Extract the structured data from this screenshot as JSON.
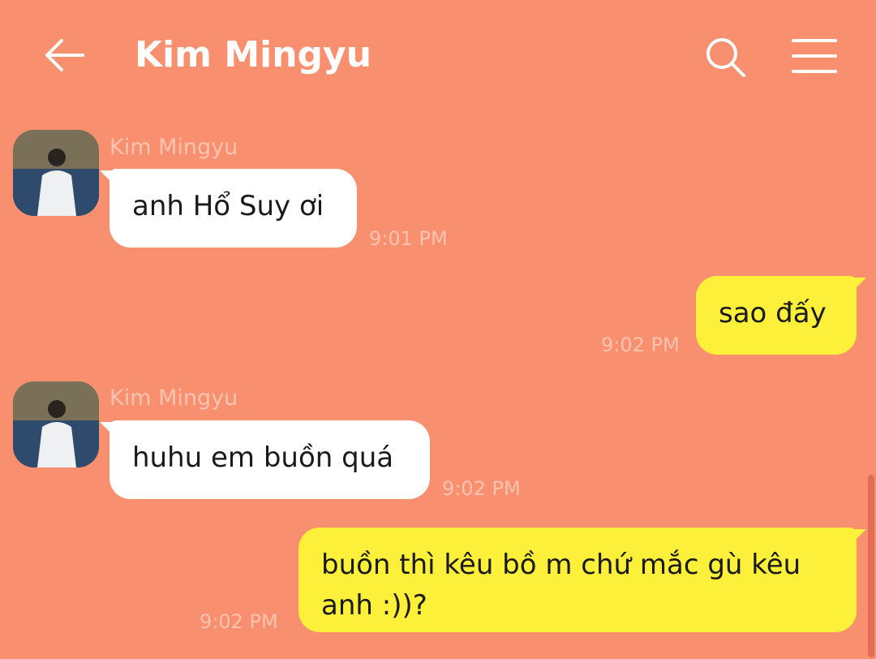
{
  "header": {
    "title": "Kim Mingyu",
    "back_icon": "arrow-left-icon",
    "search_icon": "search-icon",
    "menu_icon": "menu-icon"
  },
  "colors": {
    "background": "#F89070",
    "incoming_bubble": "#FFFFFF",
    "outgoing_bubble": "#FDF03A",
    "meta_text": "#FBC3B0"
  },
  "messages": [
    {
      "direction": "incoming",
      "sender": "Kim Mingyu",
      "text": "anh Hổ Suy ơi",
      "time": "9:01 PM"
    },
    {
      "direction": "outgoing",
      "text": "sao đấy",
      "time": "9:02 PM"
    },
    {
      "direction": "incoming",
      "sender": "Kim Mingyu",
      "text": "huhu em buồn quá",
      "time": "9:02 PM"
    },
    {
      "direction": "outgoing",
      "text": "buồn thì kêu bồ m chứ mắc gù kêu anh :))?",
      "time": "9:02 PM"
    }
  ]
}
